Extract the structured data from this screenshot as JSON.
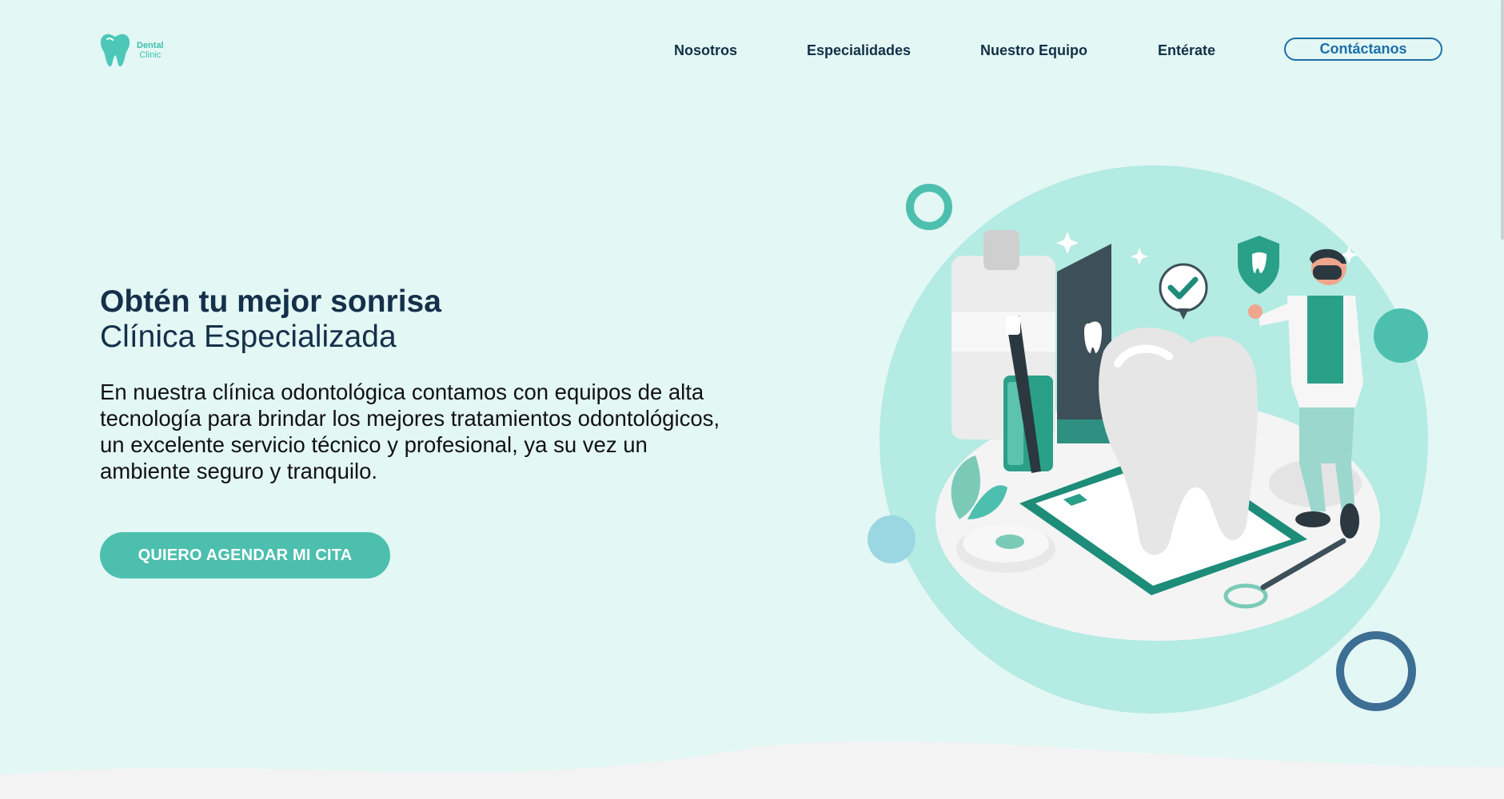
{
  "header": {
    "logo": {
      "line1": "Dental",
      "line2": "Clinic",
      "icon": "tooth-icon"
    },
    "nav": [
      "Nosotros",
      "Especialidades",
      "Nuestro Equipo",
      "Entérate"
    ],
    "cta": "Contáctanos"
  },
  "hero": {
    "title": "Obtén tu mejor sonrisa",
    "subtitle": "Clínica Especializada",
    "description": "En nuestra clínica odontológica contamos con equipos de alta tecnología para brindar los mejores tratamientos odontológicos, un excelente servicio técnico y profesional, ya su vez un ambiente seguro y tranquilo.",
    "cta": "QUIERO AGENDAR MI CITA"
  },
  "colors": {
    "background": "#e3f7f4",
    "accent": "#4dbfae",
    "navy": "#14304a",
    "link_blue": "#1c6fa8"
  }
}
